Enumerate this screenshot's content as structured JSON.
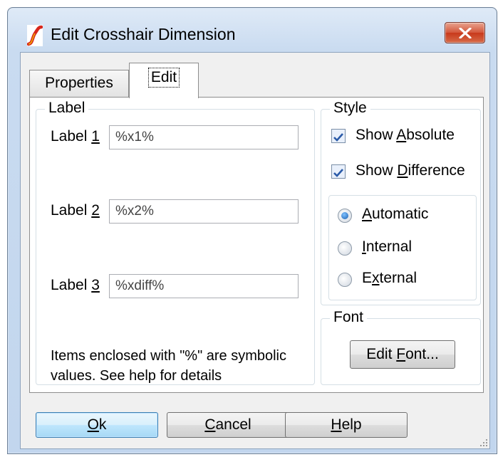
{
  "window": {
    "title": "Edit Crosshair Dimension"
  },
  "tabs": [
    {
      "label": "Properties"
    },
    {
      "label": "Edit",
      "active": true
    }
  ],
  "label_group": {
    "title": "Label",
    "rows": [
      {
        "prefix": "Label ",
        "number": "1",
        "value": "%x1%"
      },
      {
        "prefix": "Label ",
        "number": "2",
        "value": "%x2%"
      },
      {
        "prefix": "Label ",
        "number": "3",
        "value": "%xdiff%"
      }
    ],
    "note_line1": "Items enclosed with \"%\" are symbolic",
    "note_line2": "values. See help for details"
  },
  "style_group": {
    "title": "Style",
    "show_absolute": {
      "pre": "Show ",
      "key": "A",
      "post": "bsolute",
      "checked": true
    },
    "show_difference": {
      "pre": "Show ",
      "key": "D",
      "post": "ifference",
      "checked": true
    },
    "radios": [
      {
        "pre": "",
        "key": "A",
        "post": "utomatic",
        "selected": true
      },
      {
        "pre": "",
        "key": "I",
        "post": "nternal",
        "selected": false
      },
      {
        "pre": "E",
        "key": "x",
        "post": "ternal",
        "selected": false
      }
    ]
  },
  "font_group": {
    "title": "Font",
    "edit_font": {
      "pre": "Edit ",
      "key": "F",
      "post": "ont..."
    }
  },
  "buttons": {
    "ok": {
      "key": "O",
      "post": "k"
    },
    "cancel": {
      "key": "C",
      "post": "ancel"
    },
    "help": {
      "key": "H",
      "post": "elp"
    }
  },
  "colors": {
    "titlebar": "#c9dbf0",
    "close_button": "#c8391b",
    "default_button_border": "#3c7fb1",
    "check_accent": "#2a5aa8"
  },
  "icons": {
    "app": "spice-logo-icon",
    "close": "close-icon",
    "check": "checkmark-icon"
  }
}
